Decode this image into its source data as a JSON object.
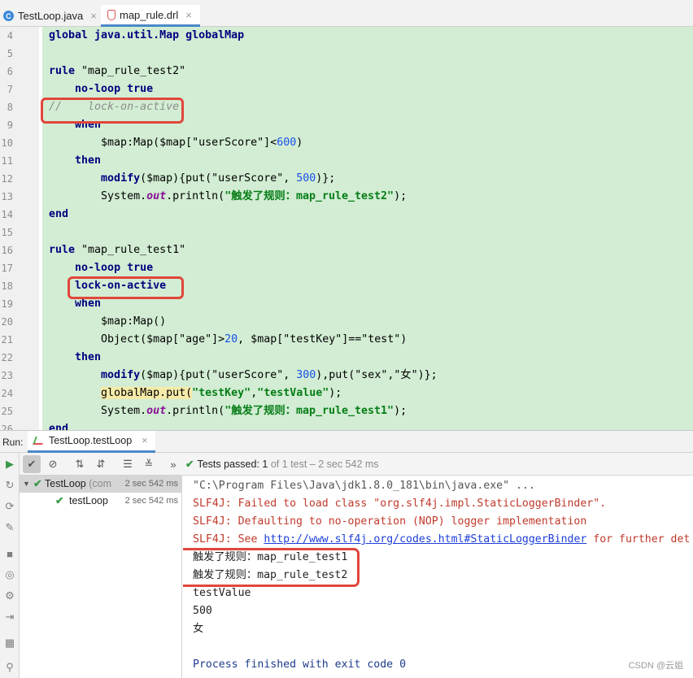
{
  "tabs": [
    {
      "label": "TestLoop.java",
      "icon": "java-class-icon",
      "close": "×"
    },
    {
      "label": "map_rule.drl",
      "icon": "drools-file-icon",
      "close": "×"
    }
  ],
  "editor": {
    "lines": [
      {
        "n": "4",
        "parts": [
          {
            "t": "global java.util.Map globalMap",
            "c": "kw"
          }
        ]
      },
      {
        "n": "5",
        "parts": []
      },
      {
        "n": "6",
        "parts": [
          {
            "t": "rule ",
            "c": "kw"
          },
          {
            "t": "\"map_rule_test2\"",
            "c": ""
          }
        ]
      },
      {
        "n": "7",
        "parts": [
          {
            "t": "    ",
            "c": ""
          },
          {
            "t": "no-loop true",
            "c": "kw"
          }
        ]
      },
      {
        "n": "8",
        "parts": [
          {
            "t": "//    lock-on-active",
            "c": "cm"
          }
        ]
      },
      {
        "n": "9",
        "parts": [
          {
            "t": "    ",
            "c": ""
          },
          {
            "t": "when",
            "c": "kw"
          }
        ]
      },
      {
        "n": "10",
        "parts": [
          {
            "t": "        $map:Map($map[\"userScore\"]<",
            "c": ""
          },
          {
            "t": "600",
            "c": "num"
          },
          {
            "t": ")",
            "c": ""
          }
        ]
      },
      {
        "n": "11",
        "parts": [
          {
            "t": "    ",
            "c": ""
          },
          {
            "t": "then",
            "c": "kw"
          }
        ]
      },
      {
        "n": "12",
        "parts": [
          {
            "t": "        ",
            "c": ""
          },
          {
            "t": "modify",
            "c": "kw"
          },
          {
            "t": "($map){put(\"userScore\", ",
            "c": ""
          },
          {
            "t": "500",
            "c": "num"
          },
          {
            "t": ")};",
            "c": ""
          }
        ]
      },
      {
        "n": "13",
        "parts": [
          {
            "t": "        System.",
            "c": ""
          },
          {
            "t": "out",
            "c": "it"
          },
          {
            "t": ".println(",
            "c": ""
          },
          {
            "t": "\"触发了规则：map_rule_test2\"",
            "c": "str"
          },
          {
            "t": ");",
            "c": ""
          }
        ]
      },
      {
        "n": "14",
        "parts": [
          {
            "t": "end",
            "c": "kw"
          }
        ]
      },
      {
        "n": "15",
        "parts": []
      },
      {
        "n": "16",
        "parts": [
          {
            "t": "rule ",
            "c": "kw"
          },
          {
            "t": "\"map_rule_test1\"",
            "c": ""
          }
        ]
      },
      {
        "n": "17",
        "parts": [
          {
            "t": "    ",
            "c": ""
          },
          {
            "t": "no-loop true",
            "c": "kw"
          }
        ]
      },
      {
        "n": "18",
        "parts": [
          {
            "t": "    ",
            "c": ""
          },
          {
            "t": "lock-on-active",
            "c": "kw"
          }
        ]
      },
      {
        "n": "19",
        "parts": [
          {
            "t": "    ",
            "c": ""
          },
          {
            "t": "when",
            "c": "kw"
          }
        ]
      },
      {
        "n": "20",
        "parts": [
          {
            "t": "        $map:Map()",
            "c": ""
          }
        ]
      },
      {
        "n": "21",
        "parts": [
          {
            "t": "        Object($map[\"age\"]>",
            "c": ""
          },
          {
            "t": "20",
            "c": "num"
          },
          {
            "t": ", $map[\"testKey\"]==\"test\")",
            "c": ""
          }
        ]
      },
      {
        "n": "22",
        "parts": [
          {
            "t": "    ",
            "c": ""
          },
          {
            "t": "then",
            "c": "kw"
          }
        ]
      },
      {
        "n": "23",
        "parts": [
          {
            "t": "        ",
            "c": ""
          },
          {
            "t": "modify",
            "c": "kw"
          },
          {
            "t": "($map){put(\"userScore\", ",
            "c": ""
          },
          {
            "t": "300",
            "c": "num"
          },
          {
            "t": "),put(\"sex\",\"女\")};",
            "c": ""
          }
        ]
      },
      {
        "n": "24",
        "parts": [
          {
            "t": "        ",
            "c": ""
          },
          {
            "t": "globalMap.put(",
            "c": "hl"
          },
          {
            "t": "\"testKey\"",
            "c": "str"
          },
          {
            "t": ",",
            "c": ""
          },
          {
            "t": "\"testValue\"",
            "c": "str"
          },
          {
            "t": ");",
            "c": ""
          }
        ]
      },
      {
        "n": "25",
        "parts": [
          {
            "t": "        System.",
            "c": ""
          },
          {
            "t": "out",
            "c": "it"
          },
          {
            "t": ".println(",
            "c": ""
          },
          {
            "t": "\"触发了规则：map_rule_test1\"",
            "c": "str"
          },
          {
            "t": ");",
            "c": ""
          }
        ]
      },
      {
        "n": "26",
        "parts": [
          {
            "t": "end",
            "c": "kw"
          }
        ]
      }
    ]
  },
  "run": {
    "label": "Run:",
    "tab_label": "TestLoop.testLoop",
    "tab_close": "×"
  },
  "toolbar": {
    "more": "»",
    "tests_passed": "Tests passed:",
    "passed_count": "1",
    "of_text": "of 1 test – 2 sec 542 ms"
  },
  "tree": {
    "root_name": "TestLoop",
    "root_detail": "(com",
    "root_time": "2 sec 542 ms",
    "child_name": "testLoop",
    "child_time": "2 sec 542 ms"
  },
  "console": {
    "lines": [
      {
        "t": "\"C:\\Program Files\\Java\\jdk1.8.0_181\\bin\\java.exe\" ...",
        "c": "c-cmd"
      },
      {
        "t": "SLF4J: Failed to load class \"org.slf4j.impl.StaticLoggerBinder\".",
        "c": "c-err"
      },
      {
        "t": "SLF4J: Defaulting to no-operation (NOP) logger implementation",
        "c": "c-err"
      },
      {
        "t": "SLF4J: See ",
        "c": "c-err",
        "link": "http://www.slf4j.org/codes.html#StaticLoggerBinder",
        "after": " for further det"
      },
      {
        "t": "触发了规则：map_rule_test1",
        "c": "c-out"
      },
      {
        "t": "触发了规则：map_rule_test2",
        "c": "c-out"
      },
      {
        "t": "testValue",
        "c": "c-out"
      },
      {
        "t": "500",
        "c": "c-out"
      },
      {
        "t": "女",
        "c": "c-out"
      },
      {
        "t": "",
        "c": "c-out"
      },
      {
        "t": "Process finished with exit code 0",
        "c": "c-done"
      }
    ],
    "watermark": "CSDN @云姐"
  },
  "colors": {
    "code_bg": "#d2edd3",
    "highlight_box": "#e2463b",
    "pass_green": "#3b9a4a"
  }
}
